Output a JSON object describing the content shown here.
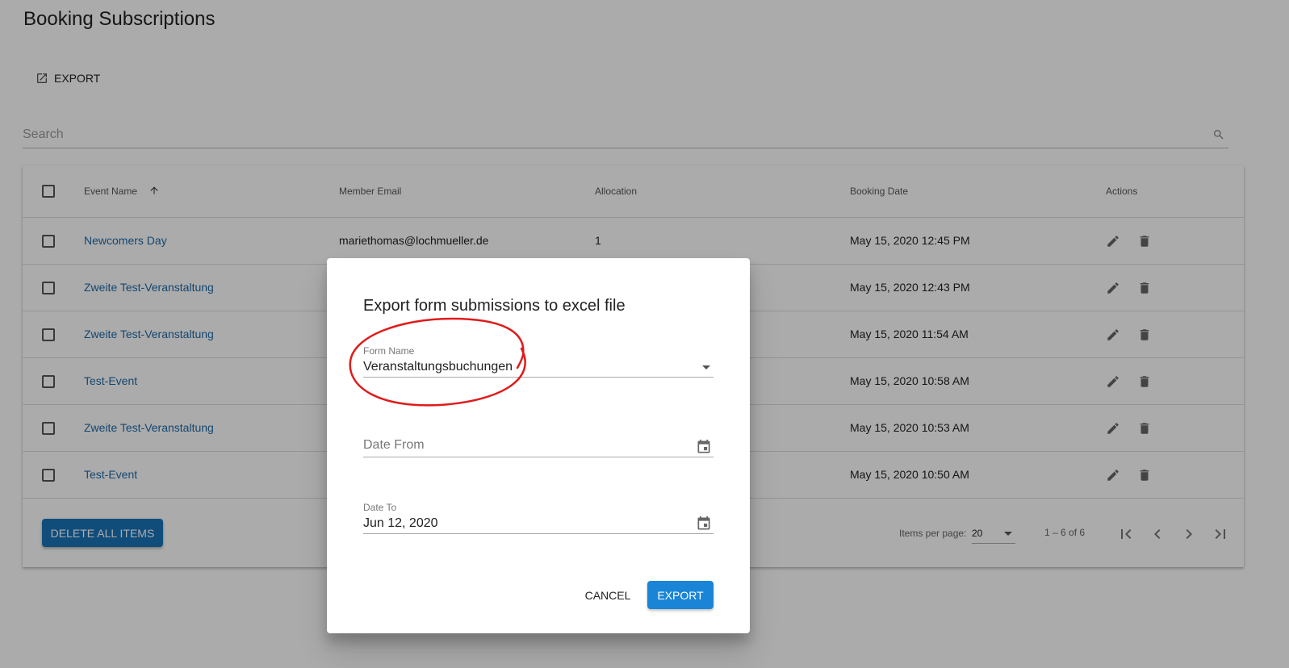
{
  "page": {
    "title": "Booking Subscriptions",
    "export_label": "EXPORT",
    "search_placeholder": "Search"
  },
  "table": {
    "columns": [
      "Event Name",
      "Member Email",
      "Allocation",
      "Booking Date",
      "Actions"
    ],
    "sort_column": "Event Name",
    "sort_direction": "ascending",
    "rows": [
      {
        "event": "Newcomers Day",
        "email": "mariethomas@lochmueller.de",
        "allocation": "1",
        "date": "May 15, 2020 12:45 PM"
      },
      {
        "event": "Zweite Test-Veranstaltung",
        "email": "",
        "allocation": "",
        "date": "May 15, 2020 12:43 PM"
      },
      {
        "event": "Zweite Test-Veranstaltung",
        "email": "",
        "allocation": "",
        "date": "May 15, 2020 11:54 AM"
      },
      {
        "event": "Test-Event",
        "email": "",
        "allocation": "",
        "date": "May 15, 2020 10:58 AM"
      },
      {
        "event": "Zweite Test-Veranstaltung",
        "email": "",
        "allocation": "",
        "date": "May 15, 2020 10:53 AM"
      },
      {
        "event": "Test-Event",
        "email": "",
        "allocation": "",
        "date": "May 15, 2020 10:50 AM"
      }
    ],
    "delete_all_label": "DELETE ALL ITEMS"
  },
  "pagination": {
    "items_per_page_label": "Items per page:",
    "items_per_page_value": "20",
    "range_label": "1 – 6 of 6"
  },
  "dialog": {
    "title": "Export form submissions to excel file",
    "form_name_label": "Form Name",
    "form_name_value": "Veranstaltungsbuchungen",
    "date_from_placeholder": "Date From",
    "date_to_label": "Date To",
    "date_to_value": "Jun 12, 2020",
    "cancel_label": "CANCEL",
    "export_label": "EXPORT"
  },
  "colors": {
    "primary_button": "#1a85d6",
    "delete_button": "#1a73b8",
    "link": "#1e6aa8",
    "annotation_circle": "#e01b1b"
  },
  "icons": [
    "open-in-new-icon",
    "search-icon",
    "sort-arrow-up-icon",
    "edit-icon",
    "delete-icon",
    "dropdown-icon",
    "calendar-icon",
    "first-page-icon",
    "previous-page-icon",
    "next-page-icon",
    "last-page-icon"
  ]
}
